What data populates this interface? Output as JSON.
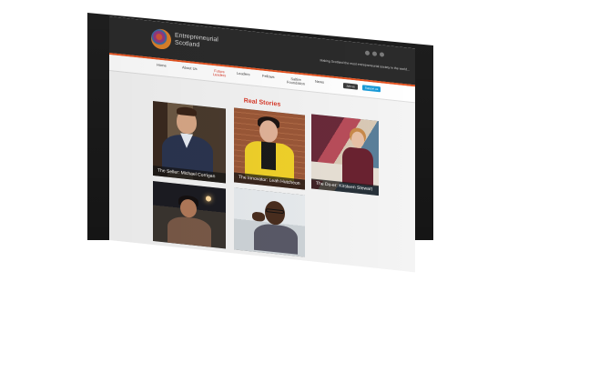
{
  "site": {
    "logo_text": "Entrepreneurial Scotland",
    "tagline": "Making Scotland the most entrepreneurial society in the world...",
    "social_icons": [
      "facebook-icon",
      "twitter-icon",
      "linkedin-icon"
    ]
  },
  "nav": {
    "items": [
      {
        "label": "Home"
      },
      {
        "label": "About Us"
      },
      {
        "label": "Future Leaders"
      },
      {
        "label": "Leaders"
      },
      {
        "label": "Fellows"
      },
      {
        "label": "Saltire Foundation"
      },
      {
        "label": "News"
      }
    ],
    "join_label": "Join us",
    "support_label": "Support us"
  },
  "page": {
    "title": "Real Stories"
  },
  "stories": [
    {
      "caption": "The Seller: Michael Corrigan"
    },
    {
      "caption": "The Innovator: Leah Hutcheon"
    },
    {
      "caption": "The Do-er: Kirsteen Stewart"
    },
    {
      "caption": ""
    },
    {
      "caption": ""
    }
  ],
  "colors": {
    "accent": "#d93a2a",
    "orange_bar": "#e8531f",
    "support_button": "#1a9bd8",
    "header": "#2b2b2b"
  }
}
